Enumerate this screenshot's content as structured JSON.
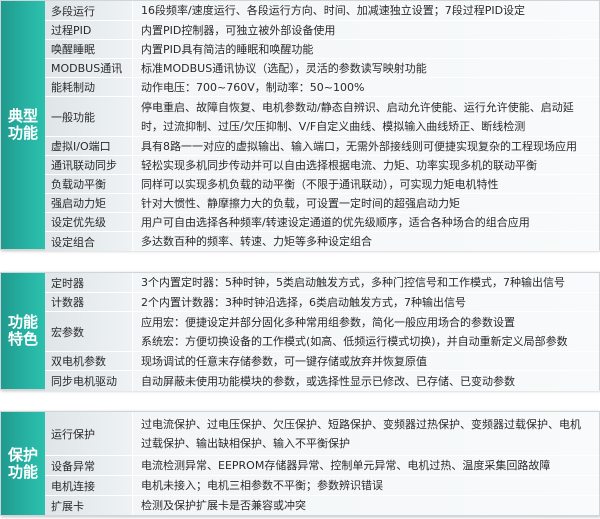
{
  "sections": [
    {
      "category": "典型功能",
      "rows": [
        {
          "name": "多段运行",
          "desc": "16段频率/速度运行、各段运行方向、时间、加减速独立设置；7段过程PID设定"
        },
        {
          "name": "过程PID",
          "desc": "内置PID控制器，可独立被外部设备使用"
        },
        {
          "name": "唤醒睡眠",
          "desc": "内置PID具有简洁的睡眠和唤醒功能"
        },
        {
          "name": "MODBUS通讯",
          "desc": "标准MODBUS通讯协议（选配），灵活的参数读写映射功能"
        },
        {
          "name": "能耗制动",
          "desc": "动作电压：700~760V，制动率：50~100%"
        },
        {
          "name": "一般功能",
          "desc": "停电重启、故障自恢复、电机参数动/静态自辨识、启动允许使能、运行允许使能、启动延时，过流抑制、过压/欠压抑制、V/F自定义曲线、模拟输入曲线矫正、断线检测"
        },
        {
          "name": "虚拟I/O端口",
          "desc": "具有8路一一对应的虚拟输出、输入端口，无需外部接线则可便捷实现复杂的工程现场应用"
        },
        {
          "name": "通讯联动同步",
          "desc": "轻松实现多机同步传动并可以自由选择根据电流、力矩、功率实现多机的联动平衡"
        },
        {
          "name": "负载动平衡",
          "desc": "同样可以实现多机负载的动平衡（不限于通讯联动），可实现力矩电机特性"
        },
        {
          "name": "强启动力矩",
          "desc": "针对大惯性、静摩擦力大的负载，可设置一定时间的超强启动力矩"
        },
        {
          "name": "设定优先级",
          "desc": "用户可自由选择各种频率/转速设定通道的优先级顺序，适合各种场合的组合应用"
        },
        {
          "name": "设定组合",
          "desc": "多达数百种的频率、转速、力矩等多种设定组合"
        }
      ]
    },
    {
      "category": "功能特色",
      "rows": [
        {
          "name": "定时器",
          "desc": "3个内置定时器：5种时钟，5类启动触发方式，多种门控信号和工作模式，7种输出信号"
        },
        {
          "name": "计数器",
          "desc": "2个内置计数器：3种时钟沿选择，6类启动触发方式，7种输出信号"
        },
        {
          "name": "宏参数",
          "lines": [
            "应用宏：便捷设定并部分固化多种常用组参数，简化一般应用场合的参数设置",
            "系统宏：方便切换设备的工作模式(如高、低频运行模式切换)，并自动重新定义局部参数"
          ]
        },
        {
          "name": "双电机参数",
          "desc": "现场调试的任意末存储参数，可一键存储或放弃并恢复原值"
        },
        {
          "name": "同步电机驱动",
          "desc": "自动屏蔽未使用功能模块的参数，或选择性显示已修改、已存储、已变动参数"
        }
      ]
    },
    {
      "category": "保护功能",
      "rows": [
        {
          "name": "运行保护",
          "desc": "过电流保护、过电压保护、欠压保护、短路保护、变频器过热保护、变频器过载保护、电机过载保护、输出缺相保护、输入不平衡保护"
        },
        {
          "name": "设备异常",
          "desc": "电流检测异常、EEPROM存储器异常、控制单元异常、电机过热、温度采集回路故障"
        },
        {
          "name": "电机连接",
          "desc": "电机未接入；电机三相参数不平衡；参数辨识错误"
        },
        {
          "name": "扩展卡",
          "desc": "检测及保护扩展卡是否兼容或冲突"
        }
      ]
    }
  ]
}
